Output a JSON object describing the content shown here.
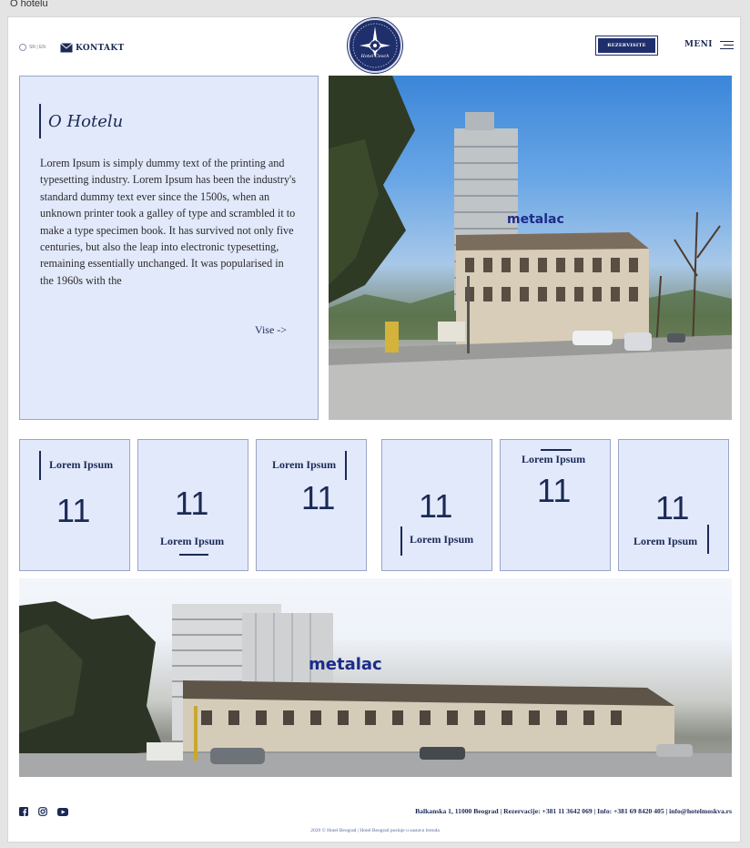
{
  "window": {
    "title": "O hotelu"
  },
  "header": {
    "language": "SR | EN",
    "contact_label": "KONTAKT",
    "logo_text": "Hotel Cesch",
    "reserve_label": "REZERVISITE",
    "menu_label": "MENI"
  },
  "about": {
    "title": "O Hotelu",
    "text": "Lorem Ipsum is simply dummy text of the printing and typesetting industry. Lorem Ipsum has been the industry's standard dummy text ever since the 1500s, when an unknown printer took a galley of type and scrambled it to make a type specimen book. It has survived not only five centuries, but also the leap into electronic typesetting, remaining essentially unchanged. It was popularised in the 1960s with the",
    "more_label": "Vise ->"
  },
  "stats": [
    {
      "label": "Lorem Ipsum",
      "value": "11"
    },
    {
      "label": "Lorem Ipsum",
      "value": "11"
    },
    {
      "label": "Lorem Ipsum",
      "value": "11"
    },
    {
      "label": "Lorem Ipsum",
      "value": "11"
    },
    {
      "label": "Lorem Ipsum",
      "value": "11"
    },
    {
      "label": "Lorem Ipsum",
      "value": "11"
    }
  ],
  "photo_text": {
    "building_sign": "metalac"
  },
  "footer": {
    "social_icons": [
      "facebook-icon",
      "instagram-icon",
      "youtube-icon"
    ],
    "address": "Balkanska 1, 11000 Beograd | Rezervacije: +381 11 3642 069 | Info: +381 69 8420 405 | info@hotelmoskva.rs",
    "copyright": "2020 © Hotel Beograd | Hotel Beograd posluje u sastavu brenda"
  },
  "colors": {
    "navy": "#1b2a55",
    "card": "#e2e9fb",
    "card_border": "#9aa6c6"
  }
}
